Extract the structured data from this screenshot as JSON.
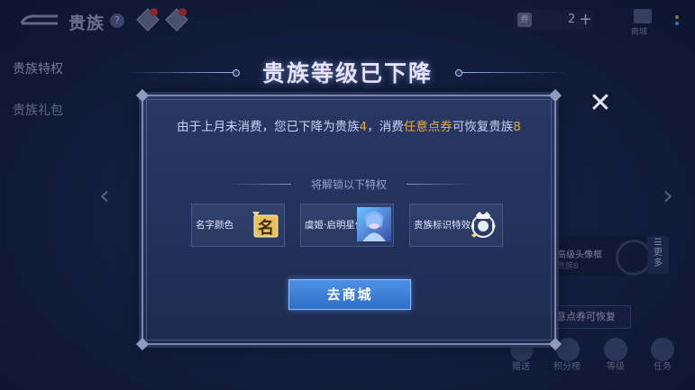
{
  "header": {
    "title": "贵族",
    "help_icon": "?",
    "currency_icon": "券",
    "currency_value": "2",
    "currency_plus": "+",
    "shop_label": "商城"
  },
  "left_menu": [
    {
      "label": "贵族特权"
    },
    {
      "label": "贵族礼包"
    }
  ],
  "background": {
    "advanced_avatar_title": "高级头像框",
    "advanced_avatar_sub": "贵族8",
    "more_label": "更多",
    "voucher_button": "意点券可恢复",
    "bottom_labels": [
      "赠送",
      "积分榜",
      "等级",
      "任务"
    ]
  },
  "dialog": {
    "title": "贵族等级已下降",
    "message_parts": [
      "由于上月未消费，您已下降为贵族",
      "4",
      "，消费",
      "任意点券",
      "可恢复贵族",
      "8"
    ],
    "unlock_label": "将解锁以下特权",
    "privileges": [
      {
        "label": "名字颜色",
        "icon": "name-color-icon",
        "icon_text": "名"
      },
      {
        "label": "虞姬·启明星使",
        "icon": "hero-skin-portrait"
      },
      {
        "label": "贵族标识特效",
        "icon": "noble-emblem-icon"
      }
    ],
    "confirm_button": "去商城",
    "close_icon": "✕"
  },
  "colors": {
    "highlight": "#e6a93c",
    "button_blue": "#3b7fd8",
    "panel": "#25345d"
  }
}
